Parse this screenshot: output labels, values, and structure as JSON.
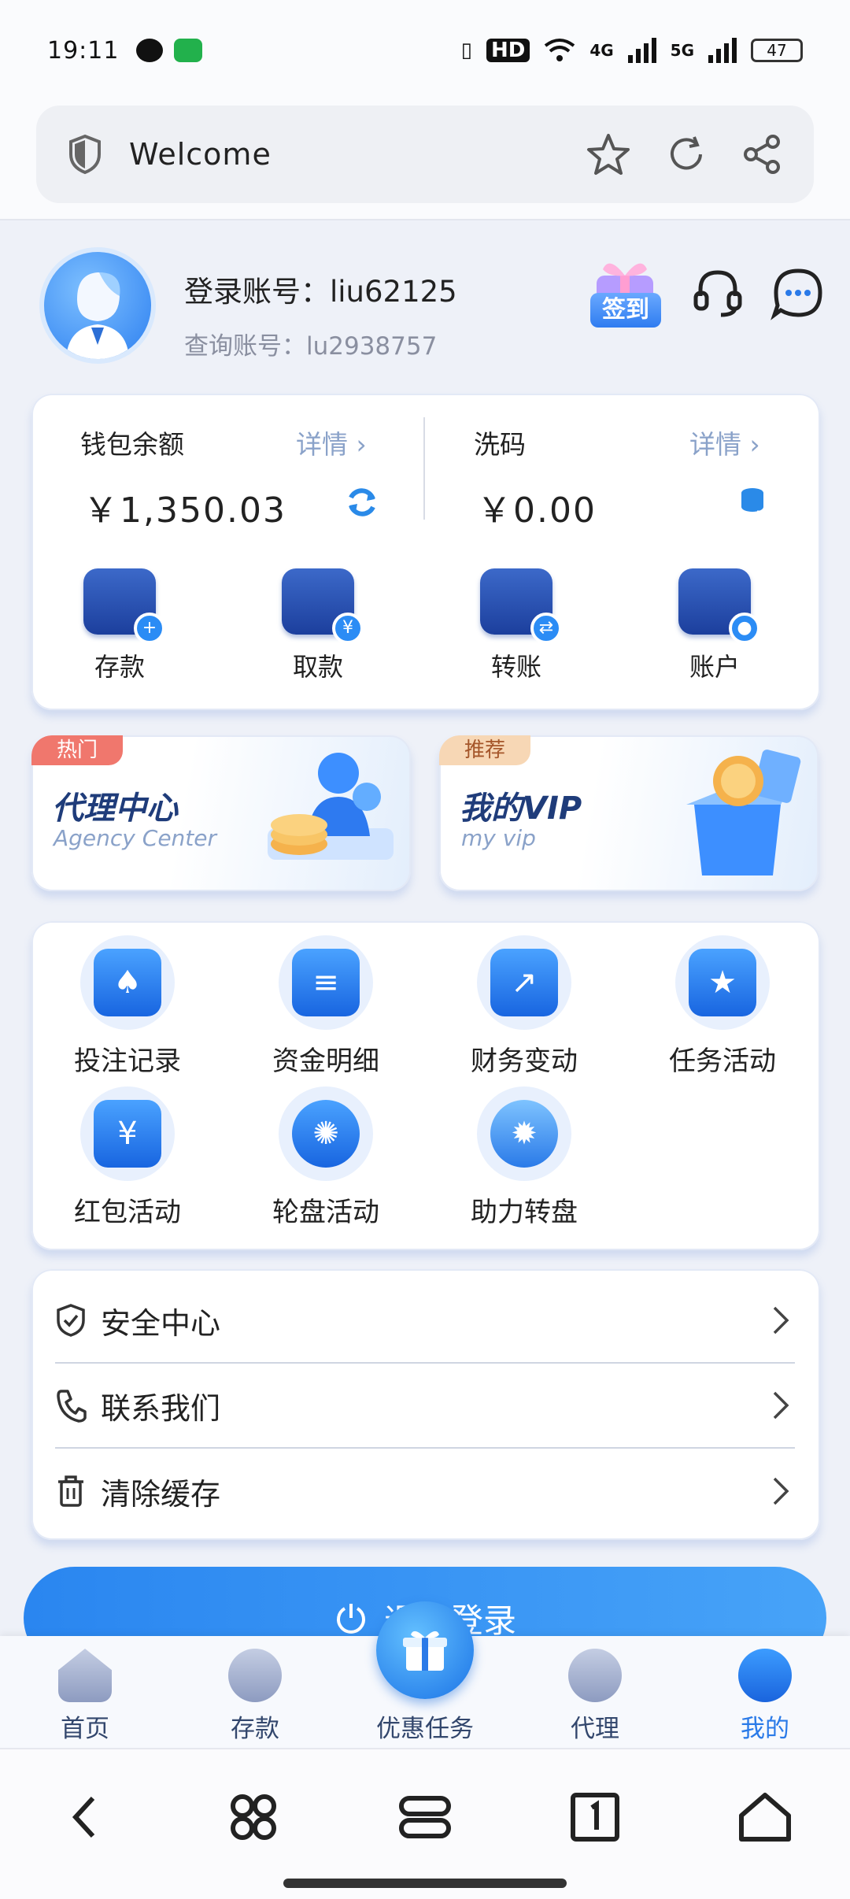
{
  "status_bar": {
    "time": "19:11",
    "network_labels": [
      "HD",
      "4G",
      "5G"
    ],
    "battery": "47"
  },
  "browser": {
    "title": "Welcome",
    "icons": [
      "shield-icon",
      "star-icon",
      "refresh-icon",
      "share-icon"
    ]
  },
  "profile": {
    "account_label": "登录账号：liu62125",
    "query_label": "查询账号：lu2938757",
    "signin_label": "签到"
  },
  "wallet": {
    "balance_label": "钱包余额",
    "balance_detail": "详情 ›",
    "balance_amount": "￥1,350.03",
    "wash_label": "洗码",
    "wash_detail": "详情 ›",
    "wash_amount": "￥0.00",
    "actions": [
      "存款",
      "取款",
      "转账",
      "账户"
    ]
  },
  "promos": {
    "agency": {
      "tag": "热门",
      "title": "代理中心",
      "subtitle": "Agency Center"
    },
    "vip": {
      "tag": "推荐",
      "title": "我的VIP",
      "subtitle": "my vip"
    }
  },
  "features": [
    "投注记录",
    "资金明细",
    "财务变动",
    "任务活动",
    "红包活动",
    "轮盘活动",
    "助力转盘"
  ],
  "menu": [
    "安全中心",
    "联系我们",
    "清除缓存"
  ],
  "logout_label": "退出登录",
  "tabs": [
    "首页",
    "存款",
    "优惠任务",
    "代理",
    "我的"
  ],
  "colors": {
    "accent": "#2a7ae8",
    "page_bg": "#eef1f8"
  }
}
